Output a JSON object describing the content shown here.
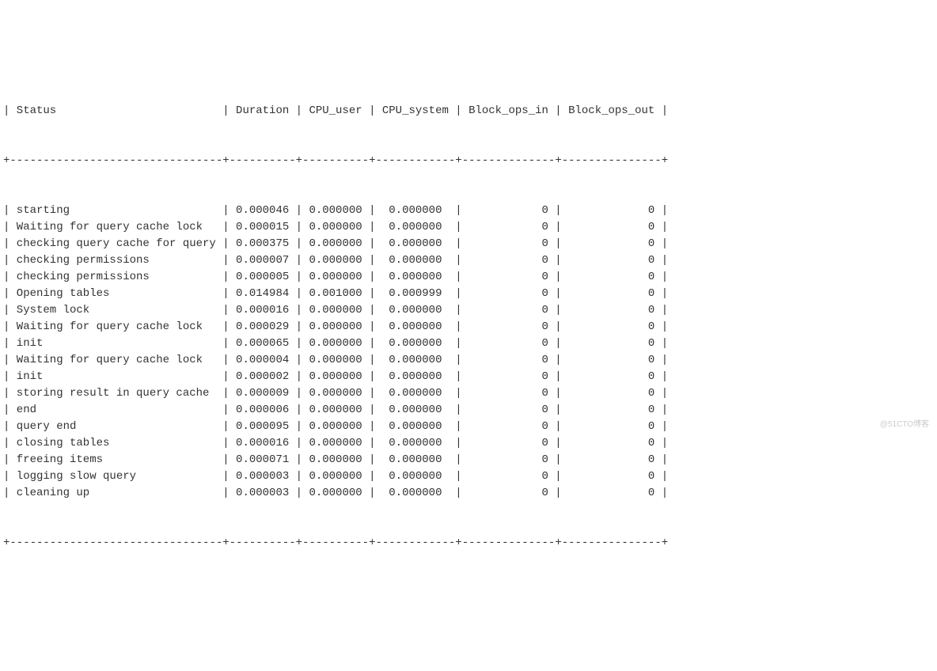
{
  "table": {
    "headers": {
      "status": "Status",
      "duration": "Duration",
      "cpu_user": "CPU_user",
      "cpu_system": "CPU_system",
      "block_ops_in": "Block_ops_in",
      "block_ops_out": "Block_ops_out"
    },
    "rows": [
      {
        "status": "starting",
        "duration": "0.000046",
        "cpu_user": "0.000000",
        "cpu_system": "0.000000",
        "block_ops_in": "0",
        "block_ops_out": "0"
      },
      {
        "status": "Waiting for query cache lock",
        "duration": "0.000015",
        "cpu_user": "0.000000",
        "cpu_system": "0.000000",
        "block_ops_in": "0",
        "block_ops_out": "0"
      },
      {
        "status": "checking query cache for query",
        "duration": "0.000375",
        "cpu_user": "0.000000",
        "cpu_system": "0.000000",
        "block_ops_in": "0",
        "block_ops_out": "0"
      },
      {
        "status": "checking permissions",
        "duration": "0.000007",
        "cpu_user": "0.000000",
        "cpu_system": "0.000000",
        "block_ops_in": "0",
        "block_ops_out": "0"
      },
      {
        "status": "checking permissions",
        "duration": "0.000005",
        "cpu_user": "0.000000",
        "cpu_system": "0.000000",
        "block_ops_in": "0",
        "block_ops_out": "0"
      },
      {
        "status": "Opening tables",
        "duration": "0.014984",
        "cpu_user": "0.001000",
        "cpu_system": "0.000999",
        "block_ops_in": "0",
        "block_ops_out": "0"
      },
      {
        "status": "System lock",
        "duration": "0.000016",
        "cpu_user": "0.000000",
        "cpu_system": "0.000000",
        "block_ops_in": "0",
        "block_ops_out": "0"
      },
      {
        "status": "Waiting for query cache lock",
        "duration": "0.000029",
        "cpu_user": "0.000000",
        "cpu_system": "0.000000",
        "block_ops_in": "0",
        "block_ops_out": "0"
      },
      {
        "status": "init",
        "duration": "0.000065",
        "cpu_user": "0.000000",
        "cpu_system": "0.000000",
        "block_ops_in": "0",
        "block_ops_out": "0"
      },
      {
        "status": "Waiting for query cache lock",
        "duration": "0.000004",
        "cpu_user": "0.000000",
        "cpu_system": "0.000000",
        "block_ops_in": "0",
        "block_ops_out": "0"
      },
      {
        "status": "init",
        "duration": "0.000002",
        "cpu_user": "0.000000",
        "cpu_system": "0.000000",
        "block_ops_in": "0",
        "block_ops_out": "0"
      },
      {
        "status": "storing result in query cache",
        "duration": "0.000009",
        "cpu_user": "0.000000",
        "cpu_system": "0.000000",
        "block_ops_in": "0",
        "block_ops_out": "0"
      },
      {
        "status": "end",
        "duration": "0.000006",
        "cpu_user": "0.000000",
        "cpu_system": "0.000000",
        "block_ops_in": "0",
        "block_ops_out": "0"
      },
      {
        "status": "query end",
        "duration": "0.000095",
        "cpu_user": "0.000000",
        "cpu_system": "0.000000",
        "block_ops_in": "0",
        "block_ops_out": "0"
      },
      {
        "status": "closing tables",
        "duration": "0.000016",
        "cpu_user": "0.000000",
        "cpu_system": "0.000000",
        "block_ops_in": "0",
        "block_ops_out": "0"
      },
      {
        "status": "freeing items",
        "duration": "0.000071",
        "cpu_user": "0.000000",
        "cpu_system": "0.000000",
        "block_ops_in": "0",
        "block_ops_out": "0"
      },
      {
        "status": "logging slow query",
        "duration": "0.000003",
        "cpu_user": "0.000000",
        "cpu_system": "0.000000",
        "block_ops_in": "0",
        "block_ops_out": "0"
      },
      {
        "status": "cleaning up",
        "duration": "0.000003",
        "cpu_user": "0.000000",
        "cpu_system": "0.000000",
        "block_ops_in": "0",
        "block_ops_out": "0"
      }
    ]
  },
  "watermark": "@51CTO博客"
}
